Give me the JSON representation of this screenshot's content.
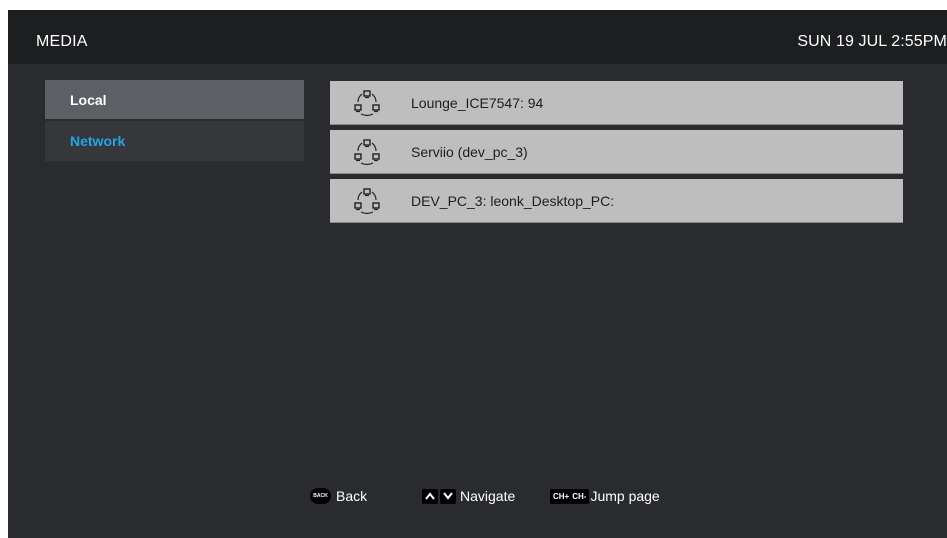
{
  "header": {
    "title": "MEDIA",
    "clock": "SUN 19 JUL 2:55PM"
  },
  "sidebar": {
    "items": [
      {
        "label": "Local",
        "selected": true
      },
      {
        "label": "Network",
        "selected": false,
        "color": "#1ea7e6"
      }
    ]
  },
  "servers": [
    {
      "label": "Lounge_ICE7547: 94",
      "icon": "network-share-icon"
    },
    {
      "label": "Serviio (dev_pc_3)",
      "icon": "network-share-icon"
    },
    {
      "label": "DEV_PC_3: leonk_Desktop_PC:",
      "icon": "network-share-icon"
    }
  ],
  "footer": {
    "back_badge": "BACK",
    "back_label": "Back",
    "navigate_label": "Navigate",
    "ch_plus": "CH+",
    "ch_minus": "CH-",
    "jump_label": "Jump page"
  },
  "colors": {
    "background": "#292b2e",
    "topbar": "#1c1e20",
    "row": "#bebebe",
    "accent": "#1ea7e6"
  }
}
